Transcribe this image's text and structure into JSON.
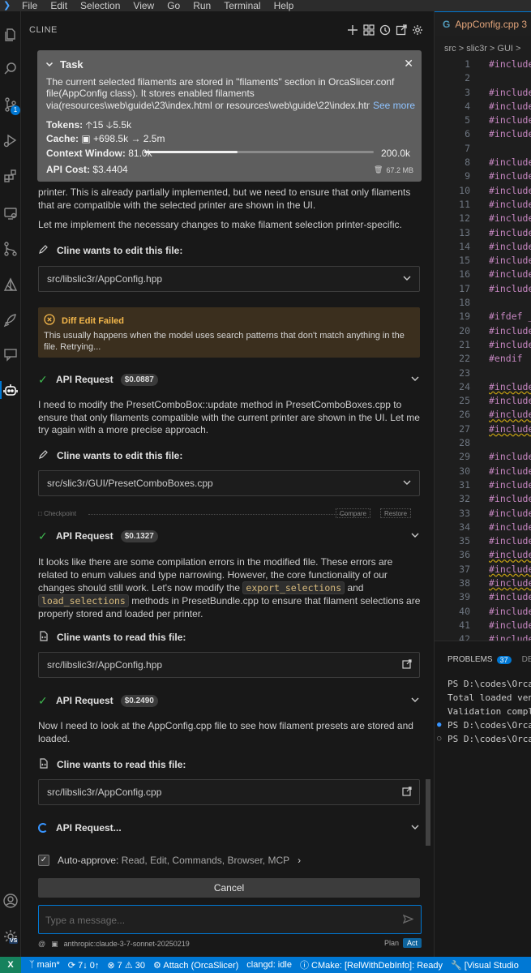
{
  "menubar": {
    "items": [
      "File",
      "Edit",
      "Selection",
      "View",
      "Go",
      "Run",
      "Terminal",
      "Help"
    ]
  },
  "activity": {
    "scm_badge": "1",
    "vs_badge": "VS"
  },
  "cline": {
    "title": "CLINE",
    "task": {
      "label": "Task",
      "description": "The current selected filaments are stored in \"filaments\" section in OrcaSlicer.conf file(AppConfig class). It stores enabled filaments via(resources\\web\\guide\\23\\index.html or resources\\web\\guide\\22\\index.htm",
      "see_more": "See more",
      "tokens_label": "Tokens:",
      "tokens_up": "15",
      "tokens_down": "5.5k",
      "cache_label": "Cache:",
      "cache_write": "+698.5k",
      "cache_read": "2.5m",
      "context_label": "Context Window:",
      "context_used": "81.0k",
      "context_max": "200.0k",
      "context_fraction": 0.405,
      "api_cost_label": "API Cost:",
      "api_cost": "$3.4404",
      "memory": "67.2 MB"
    },
    "msg1": "printer. This is already partially implemented, but we need to ensure that only filaments that are compatible with the selected printer are shown in the UI.",
    "msg2": "Let me implement the necessary changes to make filament selection printer-specific.",
    "edit1": {
      "header": "Cline wants to edit this file:",
      "path": "src/libslic3r/AppConfig.hpp"
    },
    "error": {
      "title": "Diff Edit Failed",
      "text": "This usually happens when the model uses search patterns that don't match anything in the file. Retrying..."
    },
    "api1": {
      "label": "API Request",
      "cost": "$0.0887"
    },
    "msg3": "I need to modify the PresetComboBox::update method in PresetComboBoxes.cpp to ensure that only filaments compatible with the current printer are shown in the UI. Let me try again with a more precise approach.",
    "edit2": {
      "header": "Cline wants to edit this file:",
      "path": "src/slic3r/GUI/PresetComboBoxes.cpp"
    },
    "checkpoint": {
      "label": "Checkpoint",
      "compare": "Compare",
      "restore": "Restore"
    },
    "api2": {
      "label": "API Request",
      "cost": "$0.1327"
    },
    "msg4": {
      "before": "It looks like there are some compilation errors in the modified file. These errors are related to enum values and type narrowing. However, the core functionality of our changes should still work. Let's now modify the ",
      "code1": "export_selections",
      "mid": " and ",
      "code2": "load_selections",
      "after": " methods in PresetBundle.cpp to ensure that filament selections are properly stored and loaded per printer."
    },
    "read1": {
      "header": "Cline wants to read this file:",
      "path": "src/libslic3r/AppConfig.hpp"
    },
    "api3": {
      "label": "API Request",
      "cost": "$0.2490"
    },
    "msg5": "Now I need to look at the AppConfig.cpp file to see how filament presets are stored and loaded.",
    "read2": {
      "header": "Cline wants to read this file:",
      "path": "src/libslic3r/AppConfig.cpp"
    },
    "api4": {
      "label": "API Request..."
    },
    "auto_approve": {
      "label": "Auto-approve:",
      "items": "Read, Edit, Commands, Browser, MCP"
    },
    "cancel": "Cancel",
    "input_placeholder": "Type a message...",
    "model": "anthropic:claude-3-7-sonnet-20250219",
    "mode_plan": "Plan",
    "mode_act": "Act"
  },
  "editor": {
    "tab": "AppConfig.cpp 3",
    "breadcrumb": "src > slic3r > GUI >",
    "lines": [
      {
        "n": "1",
        "t": "#include"
      },
      {
        "n": "2",
        "t": ""
      },
      {
        "n": "3",
        "t": "#include"
      },
      {
        "n": "4",
        "t": "#include"
      },
      {
        "n": "5",
        "t": "#include"
      },
      {
        "n": "6",
        "t": "#include"
      },
      {
        "n": "7",
        "t": ""
      },
      {
        "n": "8",
        "t": "#include"
      },
      {
        "n": "9",
        "t": "#include"
      },
      {
        "n": "10",
        "t": "#include"
      },
      {
        "n": "11",
        "t": "#include"
      },
      {
        "n": "12",
        "t": "#include"
      },
      {
        "n": "13",
        "t": "#include"
      },
      {
        "n": "14",
        "t": "#include"
      },
      {
        "n": "15",
        "t": "#include"
      },
      {
        "n": "16",
        "t": "#include"
      },
      {
        "n": "17",
        "t": "#include"
      },
      {
        "n": "18",
        "t": ""
      },
      {
        "n": "19",
        "t": "#ifdef _"
      },
      {
        "n": "20",
        "t": "#include"
      },
      {
        "n": "21",
        "t": "#include"
      },
      {
        "n": "22",
        "t": "#endif"
      },
      {
        "n": "23",
        "t": ""
      },
      {
        "n": "24",
        "t": "#include",
        "sq": true
      },
      {
        "n": "25",
        "t": "#include"
      },
      {
        "n": "26",
        "t": "#include",
        "sq": true
      },
      {
        "n": "27",
        "t": "#include",
        "sq": true
      },
      {
        "n": "28",
        "t": ""
      },
      {
        "n": "29",
        "t": "#include"
      },
      {
        "n": "30",
        "t": "#include"
      },
      {
        "n": "31",
        "t": "#include"
      },
      {
        "n": "32",
        "t": "#include"
      },
      {
        "n": "33",
        "t": "#include"
      },
      {
        "n": "34",
        "t": "#include"
      },
      {
        "n": "35",
        "t": "#include"
      },
      {
        "n": "36",
        "t": "#include",
        "sq": true
      },
      {
        "n": "37",
        "t": "#include",
        "sq": true
      },
      {
        "n": "38",
        "t": "#include",
        "sq": true
      },
      {
        "n": "39",
        "t": "#include"
      },
      {
        "n": "40",
        "t": "#include"
      },
      {
        "n": "41",
        "t": "#include"
      },
      {
        "n": "42",
        "t": "#include"
      }
    ]
  },
  "panel": {
    "problems_label": "PROBLEMS",
    "problems_count": "37",
    "next_tab": "DE",
    "terminal": [
      "PS D:\\codes\\Orca",
      "Total loaded ven",
      "Validation compl",
      "PS D:\\codes\\Orca",
      "PS D:\\codes\\Orca"
    ]
  },
  "statusbar": {
    "remote": "X",
    "branch": "main*",
    "sync": "7↓ 0↑",
    "errors": "7",
    "warnings": "30",
    "debug": "Attach (OrcaSlicer)",
    "clangd": "clangd: idle",
    "cmake": "CMake: [RelWithDebInfo]: Ready",
    "vs": "[Visual Studio"
  }
}
